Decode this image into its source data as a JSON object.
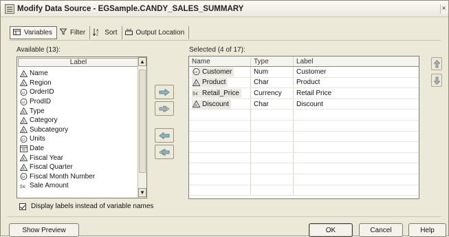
{
  "window": {
    "title": "Modify Data Source - EGSample.CANDY_SALES_SUMMARY",
    "close_glyph": "×"
  },
  "tabs": [
    {
      "label": "Variables",
      "icon": "table-icon"
    },
    {
      "label": "Filter",
      "icon": "funnel-icon"
    },
    {
      "label": "Sort",
      "icon": "sort-az-icon"
    },
    {
      "label": "Output Location",
      "icon": "output-location-icon"
    }
  ],
  "available": {
    "caption": "Available (13):",
    "header": "Label",
    "items": [
      {
        "label": "Name",
        "type": "char"
      },
      {
        "label": "Region",
        "type": "char"
      },
      {
        "label": "OrderID",
        "type": "num"
      },
      {
        "label": "ProdID",
        "type": "num"
      },
      {
        "label": "Type",
        "type": "char"
      },
      {
        "label": "Category",
        "type": "char"
      },
      {
        "label": "Subcategory",
        "type": "char"
      },
      {
        "label": "Units",
        "type": "num"
      },
      {
        "label": "Date",
        "type": "date"
      },
      {
        "label": "Fiscal Year",
        "type": "char"
      },
      {
        "label": "Fiscal Quarter",
        "type": "char"
      },
      {
        "label": "Fiscal Month Number",
        "type": "num"
      },
      {
        "label": "Sale Amount",
        "type": "currency"
      }
    ]
  },
  "selected": {
    "caption": "Selected (4 of 17):",
    "columns": [
      "Name",
      "Type",
      "Label"
    ],
    "rows": [
      {
        "name": "Customer",
        "type": "Num",
        "label": "Customer",
        "icon": "num"
      },
      {
        "name": "Product",
        "type": "Char",
        "label": "Product",
        "icon": "char"
      },
      {
        "name": "Retail_Price",
        "type": "Currency",
        "label": "Retail Price",
        "icon": "currency"
      },
      {
        "name": "Discount",
        "type": "Char",
        "label": "Discount",
        "icon": "char"
      }
    ]
  },
  "options": {
    "display_labels": "Display labels instead of variable names",
    "display_labels_checked": true
  },
  "buttons": {
    "show_preview": "Show Preview",
    "ok": "OK",
    "cancel": "Cancel",
    "help": "Help"
  },
  "colors": {
    "window_bg": "#ece9d8",
    "arrow_green": "#7fa8b5",
    "arrow_gray": "#9aa5ad"
  }
}
